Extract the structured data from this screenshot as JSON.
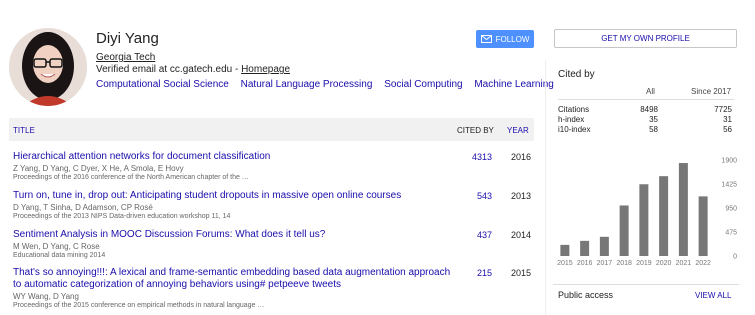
{
  "profile": {
    "name": "Diyi Yang",
    "affiliation": "Georgia Tech",
    "email_text": "Verified email at cc.gatech.edu - ",
    "homepage": "Homepage",
    "interests": [
      "Computational Social Science",
      "Natural Language Processing",
      "Social Computing",
      "Machine Learning"
    ],
    "follow_label": "FOLLOW"
  },
  "table": {
    "headers": {
      "title": "TITLE",
      "cited_by": "CITED BY",
      "year": "YEAR"
    },
    "rows": [
      {
        "title": "Hierarchical attention networks for document classification",
        "authors": "Z Yang, D Yang, C Dyer, X He, A Smola, E Hovy",
        "venue": "Proceedings of the 2016 conference of the North American chapter of the …",
        "cited": "4313",
        "year": "2016"
      },
      {
        "title": "Turn on, tune in, drop out: Anticipating student dropouts in massive open online courses",
        "authors": "D Yang, T Sinha, D Adamson, CP Rosé",
        "venue": "Proceedings of the 2013 NIPS Data-driven education workshop 11, 14",
        "cited": "543",
        "year": "2013"
      },
      {
        "title": "Sentiment Analysis in MOOC Discussion Forums: What does it tell us?",
        "authors": "M Wen, D Yang, C Rose",
        "venue": "Educational data mining 2014",
        "cited": "437",
        "year": "2014"
      },
      {
        "title": "That's so annoying!!!: A lexical and frame-semantic embedding based data augmentation approach to automatic categorization of annoying behaviors using# petpeeve tweets",
        "authors": "WY Wang, D Yang",
        "venue": "Proceedings of the 2015 conference on empirical methods in natural language …",
        "cited": "215",
        "year": "2015"
      }
    ]
  },
  "sidebar": {
    "get_profile_label": "GET MY OWN PROFILE",
    "cited_by_title": "Cited by",
    "metrics_headers": {
      "all": "All",
      "since": "Since 2017"
    },
    "metrics": [
      {
        "label": "Citations",
        "all": "8498",
        "since": "7725"
      },
      {
        "label": "h-index",
        "all": "35",
        "since": "31"
      },
      {
        "label": "i10-index",
        "all": "58",
        "since": "56"
      }
    ],
    "public_access": "Public access",
    "view_all": "VIEW ALL"
  },
  "chart_data": {
    "type": "bar",
    "categories": [
      "2015",
      "2016",
      "2017",
      "2018",
      "2019",
      "2020",
      "2021",
      "2022"
    ],
    "values": [
      220,
      300,
      380,
      1000,
      1420,
      1580,
      1840,
      1180
    ],
    "yticks": [
      "1900",
      "1425",
      "950",
      "475",
      "0"
    ],
    "ylim": [
      0,
      1900
    ],
    "bar_color": "#777777"
  },
  "colors": {
    "link": "#1a0dab",
    "follow_bg": "#4d90fe",
    "header_bg": "#f1f1f1"
  }
}
